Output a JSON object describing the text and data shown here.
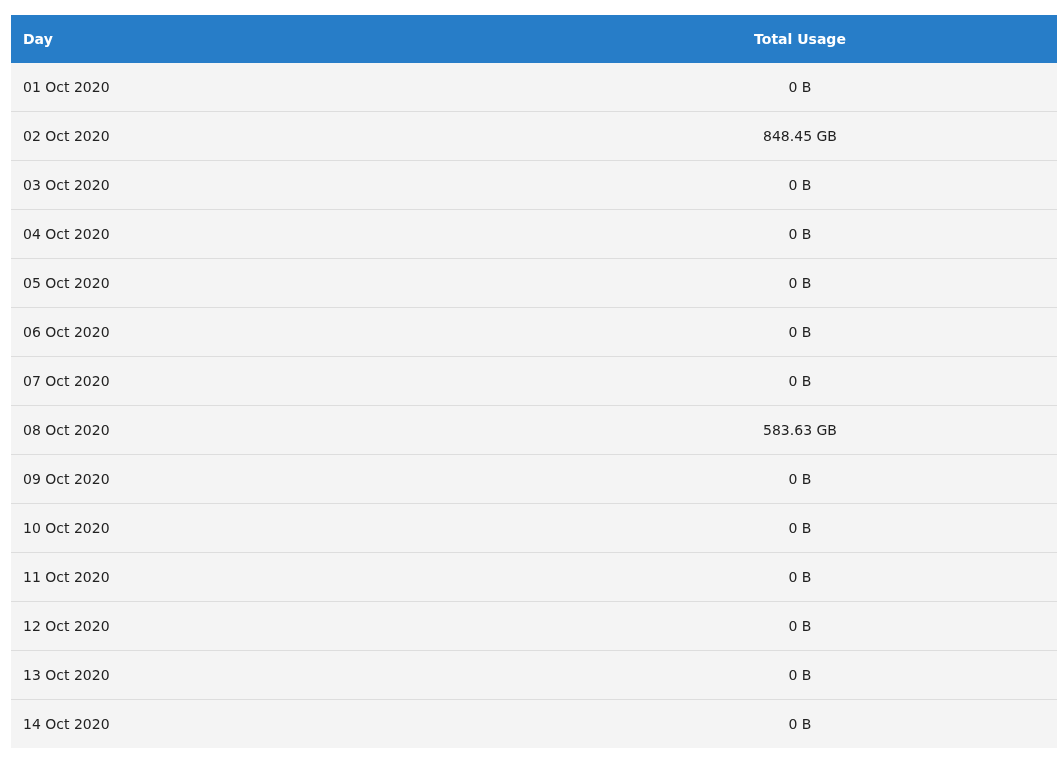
{
  "table": {
    "columns": [
      "Day",
      "Total Usage"
    ],
    "rows": [
      {
        "day": "01 Oct 2020",
        "usage": "0 B"
      },
      {
        "day": "02 Oct 2020",
        "usage": "848.45 GB"
      },
      {
        "day": "03 Oct 2020",
        "usage": "0 B"
      },
      {
        "day": "04 Oct 2020",
        "usage": "0 B"
      },
      {
        "day": "05 Oct 2020",
        "usage": "0 B"
      },
      {
        "day": "06 Oct 2020",
        "usage": "0 B"
      },
      {
        "day": "07 Oct 2020",
        "usage": "0 B"
      },
      {
        "day": "08 Oct 2020",
        "usage": "583.63 GB"
      },
      {
        "day": "09 Oct 2020",
        "usage": "0 B"
      },
      {
        "day": "10 Oct 2020",
        "usage": "0 B"
      },
      {
        "day": "11 Oct 2020",
        "usage": "0 B"
      },
      {
        "day": "12 Oct 2020",
        "usage": "0 B"
      },
      {
        "day": "13 Oct 2020",
        "usage": "0 B"
      },
      {
        "day": "14 Oct 2020",
        "usage": "0 B"
      }
    ]
  }
}
